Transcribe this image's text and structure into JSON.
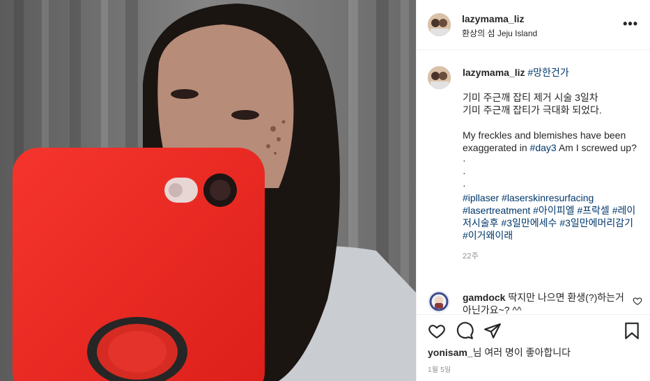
{
  "post": {
    "username": "lazymama_liz",
    "location": "환상의 섬 Jeju Island",
    "more_label": "•••",
    "caption": {
      "username": "lazymama_liz",
      "first_tag": "#망한건가",
      "line1": "기미 주근깨 잡티 제거 시술 3일차",
      "line2": "기미 주근깨 잡티가 극대화 되었다.",
      "en_part1": "My freckles and blemishes have been exaggerated in",
      "en_tag": "#day3",
      "en_part2": "Am I screwed up?",
      "dots": [
        "·",
        "·",
        "·"
      ],
      "hashtags": [
        "#ipllaser",
        "#laserskinresurfacing",
        "#lasertreatment",
        "#아이피엘",
        "#프락셀",
        "#레이저시술후",
        "#3일만에세수",
        "#3일만에머리감기",
        "#이거왜이래"
      ],
      "time": "22주"
    },
    "reply": {
      "username": "gamdock",
      "text": "딱지만 나으면 환생(?)하는거 아닌가요~? ^^"
    },
    "likes": {
      "user": "yonisam_",
      "suffix": "님 여러 명이 좋아합니다"
    },
    "date": "1월 5일"
  },
  "icons": [
    "heart-icon",
    "comment-icon",
    "share-icon",
    "bookmark-icon",
    "more-icon"
  ]
}
